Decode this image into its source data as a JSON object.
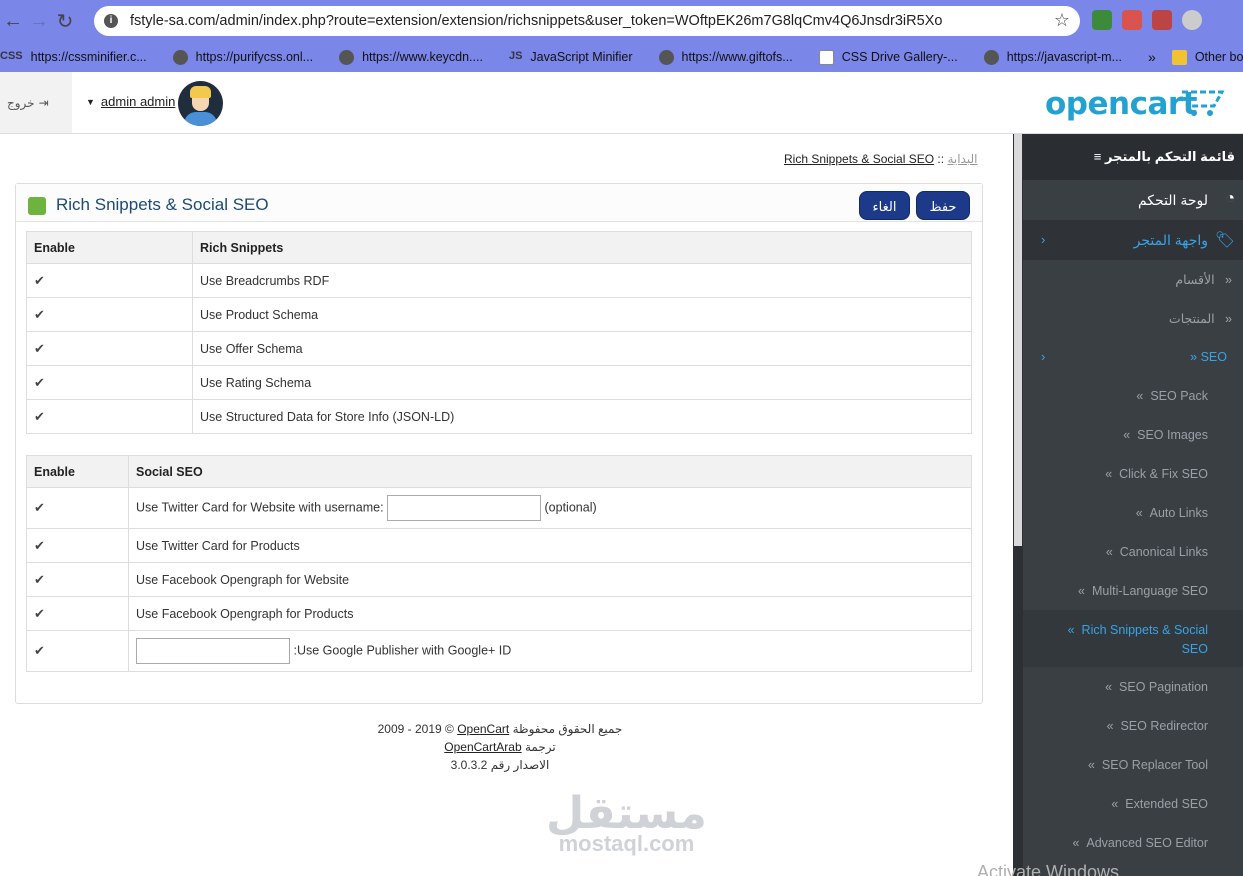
{
  "browser": {
    "url": "fstyle-sa.com/admin/index.php?route=extension/extension/richsnippets&user_token=WOftpEK26m7G8lqCmv4Q6Jnsdr3iR5Xo",
    "bookmarks": [
      {
        "label": "https://cssminifier.c...",
        "icon": "css-icon"
      },
      {
        "label": "https://purifycss.onl...",
        "icon": "globe-icon"
      },
      {
        "label": "https://www.keycdn....",
        "icon": "globe-icon"
      },
      {
        "label": "JavaScript Minifier",
        "icon": "js-icon"
      },
      {
        "label": "https://www.giftofs...",
        "icon": "globe-icon"
      },
      {
        "label": "CSS Drive Gallery-...",
        "icon": "page-icon"
      },
      {
        "label": "https://javascript-m...",
        "icon": "globe-icon"
      }
    ],
    "more": "»",
    "other_bookmarks": "Other bookmarks"
  },
  "header": {
    "logout": "خروج",
    "user_name": "admin admin",
    "logo": "opencart"
  },
  "breadcrumb": {
    "home": "البداية",
    "sep": "::",
    "current": "Rich Snippets & Social SEO"
  },
  "panel": {
    "title": "Rich Snippets & Social SEO",
    "save_label": "حفظ",
    "cancel_label": "الغاء"
  },
  "rich_table": {
    "col_enable": "Enable",
    "col_name": "Rich Snippets",
    "rows": [
      "Use Breadcrumbs RDF",
      "Use Product Schema",
      "Use Offer Schema",
      "Use Rating Schema",
      "Use Structured Data for Store Info (JSON-LD)"
    ]
  },
  "social_table": {
    "col_enable": "Enable",
    "col_name": "Social SEO",
    "twitter_label": "Use Twitter Card for Website with username:",
    "twitter_optional": "(optional)",
    "rows": [
      "Use Twitter Card for Products",
      "Use Facebook Opengraph for Website",
      "Use Facebook Opengraph for Products"
    ],
    "google_label": ":Use Google Publisher with Google+ ID"
  },
  "footer": {
    "line1_prefix": "2009 - 2019 ©",
    "line1_link": "OpenCart",
    "line1_suffix": "جميع الحقوق محفوظة",
    "line2_prefix": "ترجمة",
    "line2_link": "OpenCartArab",
    "line3": "الاصدار رقم 3.0.3.2"
  },
  "watermark": {
    "ar": "مستقل",
    "en": "mostaql.com"
  },
  "activate": "Activate Windows",
  "sidebar": {
    "heading": "≡ قائمة التحكم بالمتجر",
    "dashboard": "لوحة التحكم",
    "storefront": "واجهة المتجر",
    "categories": "الأقسام",
    "products": "المنتجات",
    "seo": "SEO",
    "seo_items": [
      "SEO Pack",
      "SEO Images",
      "Click & Fix SEO",
      "Auto Links",
      "Canonical Links",
      "Multi-Language SEO"
    ],
    "current_item_1": "Rich Snippets & Social",
    "current_item_2": "SEO",
    "more_items": [
      "SEO Pagination",
      "SEO Redirector",
      "SEO Replacer Tool",
      "Extended SEO",
      "Advanced SEO Editor"
    ],
    "chevron": "«"
  },
  "colors": {
    "accent": "#3aa3e3",
    "button": "#1d3a8a",
    "sidebar_bg": "#3a3f44",
    "chrome_bg": "#7a86e8"
  }
}
